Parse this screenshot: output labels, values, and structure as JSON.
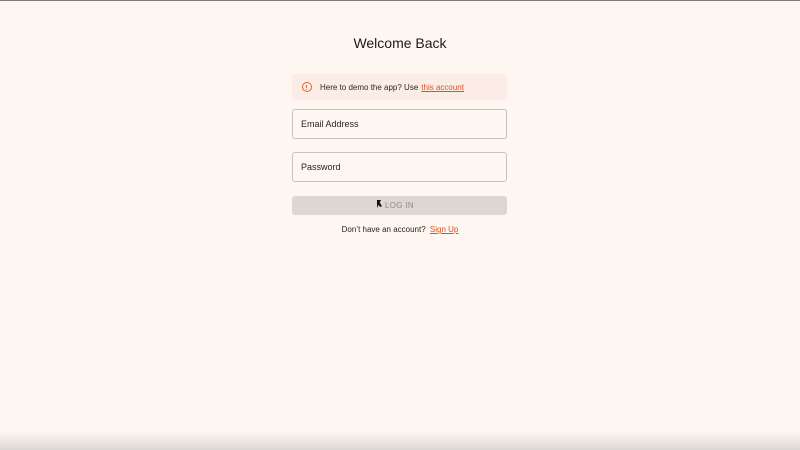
{
  "page": {
    "title": "Welcome Back"
  },
  "demo_alert": {
    "text": "Here to demo the app? Use",
    "link_label": "this account",
    "icon": "info-icon"
  },
  "form": {
    "email_placeholder": "Email Address",
    "email_value": "",
    "password_placeholder": "Password",
    "password_value": "",
    "login_label": "LOG IN"
  },
  "signup": {
    "prompt": "Don’t have an account?",
    "link_label": "Sign Up"
  },
  "colors": {
    "background": "#fdf6f1",
    "accent": "#d9531e",
    "alert_background": "#fbede6",
    "button_disabled": "#dcd7d3"
  }
}
